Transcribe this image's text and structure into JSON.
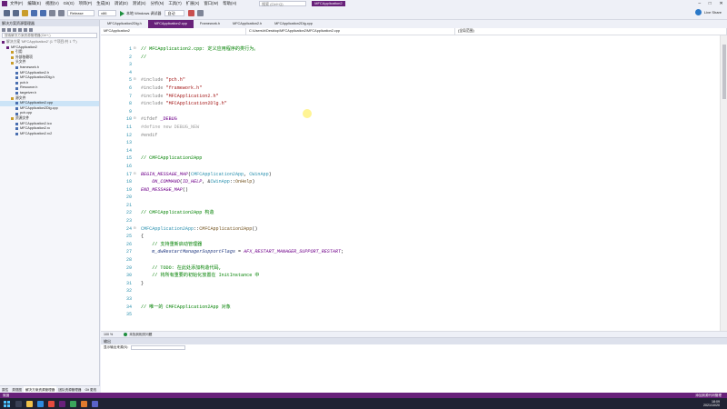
{
  "menu": {
    "items": [
      "文件(F)",
      "编辑(E)",
      "视图(V)",
      "Git(G)",
      "项目(P)",
      "生成(B)",
      "调试(D)",
      "测试(S)",
      "分析(N)",
      "工具(T)",
      "扩展(X)",
      "窗口(W)",
      "帮助(H)"
    ],
    "search_placeholder": "搜索 (Ctrl+Q)",
    "project_badge": "MFCApplication2"
  },
  "toolbar": {
    "config": "Release",
    "platform": "x86",
    "run_label": "本地 Windows 调试器",
    "run_mode": "自动",
    "liveshare": "Live Share"
  },
  "sidebar": {
    "title": "解决方案资源管理器",
    "search_placeholder": "搜索解决方案资源管理器(Ctrl+;)",
    "tree": [
      {
        "label": "解决方案 'MFCApplication2' (1 个项目/共 1 个)",
        "indent": 0,
        "color": "#6d6d6d"
      },
      {
        "label": "MFCApplication2",
        "indent": 1,
        "color": "#1e1e1e"
      },
      {
        "label": "引用",
        "indent": 2,
        "color": "#1e1e1e"
      },
      {
        "label": "外部依赖项",
        "indent": 2,
        "color": "#1e1e1e"
      },
      {
        "label": "头文件",
        "indent": 2,
        "color": "#1e1e1e"
      },
      {
        "label": "framework.h",
        "indent": 3,
        "color": "#1e1e1e"
      },
      {
        "label": "MFCApplication2.h",
        "indent": 3,
        "color": "#1e1e1e"
      },
      {
        "label": "MFCApplication2Dlg.h",
        "indent": 3,
        "color": "#1e1e1e"
      },
      {
        "label": "pch.h",
        "indent": 3,
        "color": "#1e1e1e"
      },
      {
        "label": "Resource.h",
        "indent": 3,
        "color": "#1e1e1e"
      },
      {
        "label": "targetver.h",
        "indent": 3,
        "color": "#1e1e1e"
      },
      {
        "label": "源文件",
        "indent": 2,
        "color": "#1e1e1e"
      },
      {
        "label": "MFCApplication2.cpp",
        "indent": 3,
        "color": "#1e1e1e",
        "selected": true
      },
      {
        "label": "MFCApplication2Dlg.cpp",
        "indent": 3,
        "color": "#1e1e1e"
      },
      {
        "label": "pch.cpp",
        "indent": 3,
        "color": "#1e1e1e"
      },
      {
        "label": "资源文件",
        "indent": 2,
        "color": "#1e1e1e"
      },
      {
        "label": "MFCApplication2.ico",
        "indent": 3,
        "color": "#1e1e1e"
      },
      {
        "label": "MFCApplication2.rc",
        "indent": 3,
        "color": "#1e1e1e"
      },
      {
        "label": "MFCApplication2.rc2",
        "indent": 3,
        "color": "#1e1e1e"
      }
    ],
    "tabs": [
      "属性",
      "类视图",
      "解决方案资源管理器",
      "团队资源管理器",
      "Git 更改"
    ]
  },
  "tabs": [
    {
      "label": "MFCApplication2Dlg.h",
      "active": false
    },
    {
      "label": "MFCApplication2.cpp",
      "active": true
    },
    {
      "label": "Framework.h",
      "active": false
    },
    {
      "label": "MFCApplication2.h",
      "active": false
    },
    {
      "label": "MFCApplication2Dlg.cpp",
      "active": false
    }
  ],
  "nav": {
    "project": "MFCApplication2",
    "path": "C:\\Users\\lr\\Desktop\\MFCApplication2\\MFCApplication2.cpp",
    "scope": "(全局范围)"
  },
  "code": {
    "line_numbers": [
      "1",
      "2",
      "3",
      "4",
      "5",
      "6",
      "7",
      "8",
      "9",
      "10",
      "11",
      "12",
      "13",
      "14",
      "15",
      "16",
      "17",
      "18",
      "19",
      "20",
      "21",
      "22",
      "23",
      "24",
      "25",
      "26",
      "27",
      "28",
      "29",
      "30",
      "31",
      "32",
      "33",
      "34",
      "35"
    ],
    "lines": [
      [
        {
          "t": "// MFCApplication2.cpp: 定义应用程序的类行为。",
          "c": "cm"
        }
      ],
      [
        {
          "t": "//",
          "c": "cm"
        }
      ],
      [],
      [],
      [
        {
          "t": "#include ",
          "c": "pp"
        },
        {
          "t": "\"pch.h\"",
          "c": "st"
        }
      ],
      [
        {
          "t": "#include ",
          "c": "pp"
        },
        {
          "t": "\"framework.h\"",
          "c": "st"
        }
      ],
      [
        {
          "t": "#include ",
          "c": "pp"
        },
        {
          "t": "\"MFCApplication2.h\"",
          "c": "st"
        }
      ],
      [
        {
          "t": "#include ",
          "c": "pp"
        },
        {
          "t": "\"MFCApplication2Dlg.h\"",
          "c": "st"
        }
      ],
      [],
      [
        {
          "t": "#ifdef ",
          "c": "pp"
        },
        {
          "t": "_DEBUG",
          "c": "mc"
        }
      ],
      [
        {
          "t": "#define new DEBUG_NEW",
          "c": "dim"
        }
      ],
      [
        {
          "t": "#endif",
          "c": "pp"
        }
      ],
      [],
      [],
      [
        {
          "t": "// CMFCApplication2App",
          "c": "cm"
        }
      ],
      [],
      [
        {
          "t": "BEGIN_MESSAGE_MAP",
          "c": "mc-i"
        },
        {
          "t": "(",
          "c": ""
        },
        {
          "t": "CMFCApplication2App",
          "c": "ty"
        },
        {
          "t": ", ",
          "c": ""
        },
        {
          "t": "CWinApp",
          "c": "ty"
        },
        {
          "t": ")",
          "c": ""
        }
      ],
      [
        {
          "t": "    ON_COMMAND",
          "c": "mc-i"
        },
        {
          "t": "(",
          "c": ""
        },
        {
          "t": "ID_HELP",
          "c": "mc-i"
        },
        {
          "t": ", &",
          "c": ""
        },
        {
          "t": "CWinApp",
          "c": "ty"
        },
        {
          "t": "::",
          "c": ""
        },
        {
          "t": "OnHelp",
          "c": "fn"
        },
        {
          "t": ")",
          "c": ""
        }
      ],
      [
        {
          "t": "END_MESSAGE_MAP",
          "c": "mc-i"
        },
        {
          "t": "()",
          "c": ""
        }
      ],
      [],
      [],
      [
        {
          "t": "// CMFCApplication2App 构造",
          "c": "cm"
        }
      ],
      [],
      [
        {
          "t": "CMFCApplication2App",
          "c": "ty"
        },
        {
          "t": "::",
          "c": ""
        },
        {
          "t": "CMFCApplication2App",
          "c": "fn"
        },
        {
          "t": "()",
          "c": ""
        }
      ],
      [
        {
          "t": "{",
          "c": ""
        }
      ],
      [
        {
          "t": "    // 支持重新启动管理器",
          "c": "cm"
        }
      ],
      [
        {
          "t": "    m_dwRestartManagerSupportFlags",
          "c": "mem"
        },
        {
          "t": " = ",
          "c": ""
        },
        {
          "t": "AFX_RESTART_MANAGER_SUPPORT_RESTART",
          "c": "mc-i"
        },
        {
          "t": ";",
          "c": ""
        }
      ],
      [],
      [
        {
          "t": "    // TODO: 在此处添加构造代码,",
          "c": "cm"
        }
      ],
      [
        {
          "t": "    // 将所有重要的初始化放置在 InitInstance 中",
          "c": "cm"
        }
      ],
      [
        {
          "t": "}",
          "c": ""
        }
      ],
      [],
      [],
      [
        {
          "t": "// 唯一的 CMFCApplication2App 对象",
          "c": "cm"
        }
      ],
      []
    ],
    "folds": {
      "1": "⊟",
      "5": "⊟",
      "10": "⊟",
      "17": "⊟",
      "24": "⊟"
    }
  },
  "editor_status": {
    "zoom": "100 %",
    "issues": "未找到相关问题"
  },
  "output": {
    "title": "输出",
    "source_label": "显示输出来源(S):"
  },
  "statusbar": {
    "left": "就绪",
    "right": "添加到源代码管理"
  },
  "taskbar": {
    "time": "18:09",
    "date": "2021/10/20"
  },
  "colors": {
    "accent": "#68217a",
    "comment": "#008000",
    "string": "#a31515",
    "keyword": "#0000ff",
    "macro": "#6f008a",
    "type": "#2b91af",
    "line_number": "#2b91af"
  }
}
